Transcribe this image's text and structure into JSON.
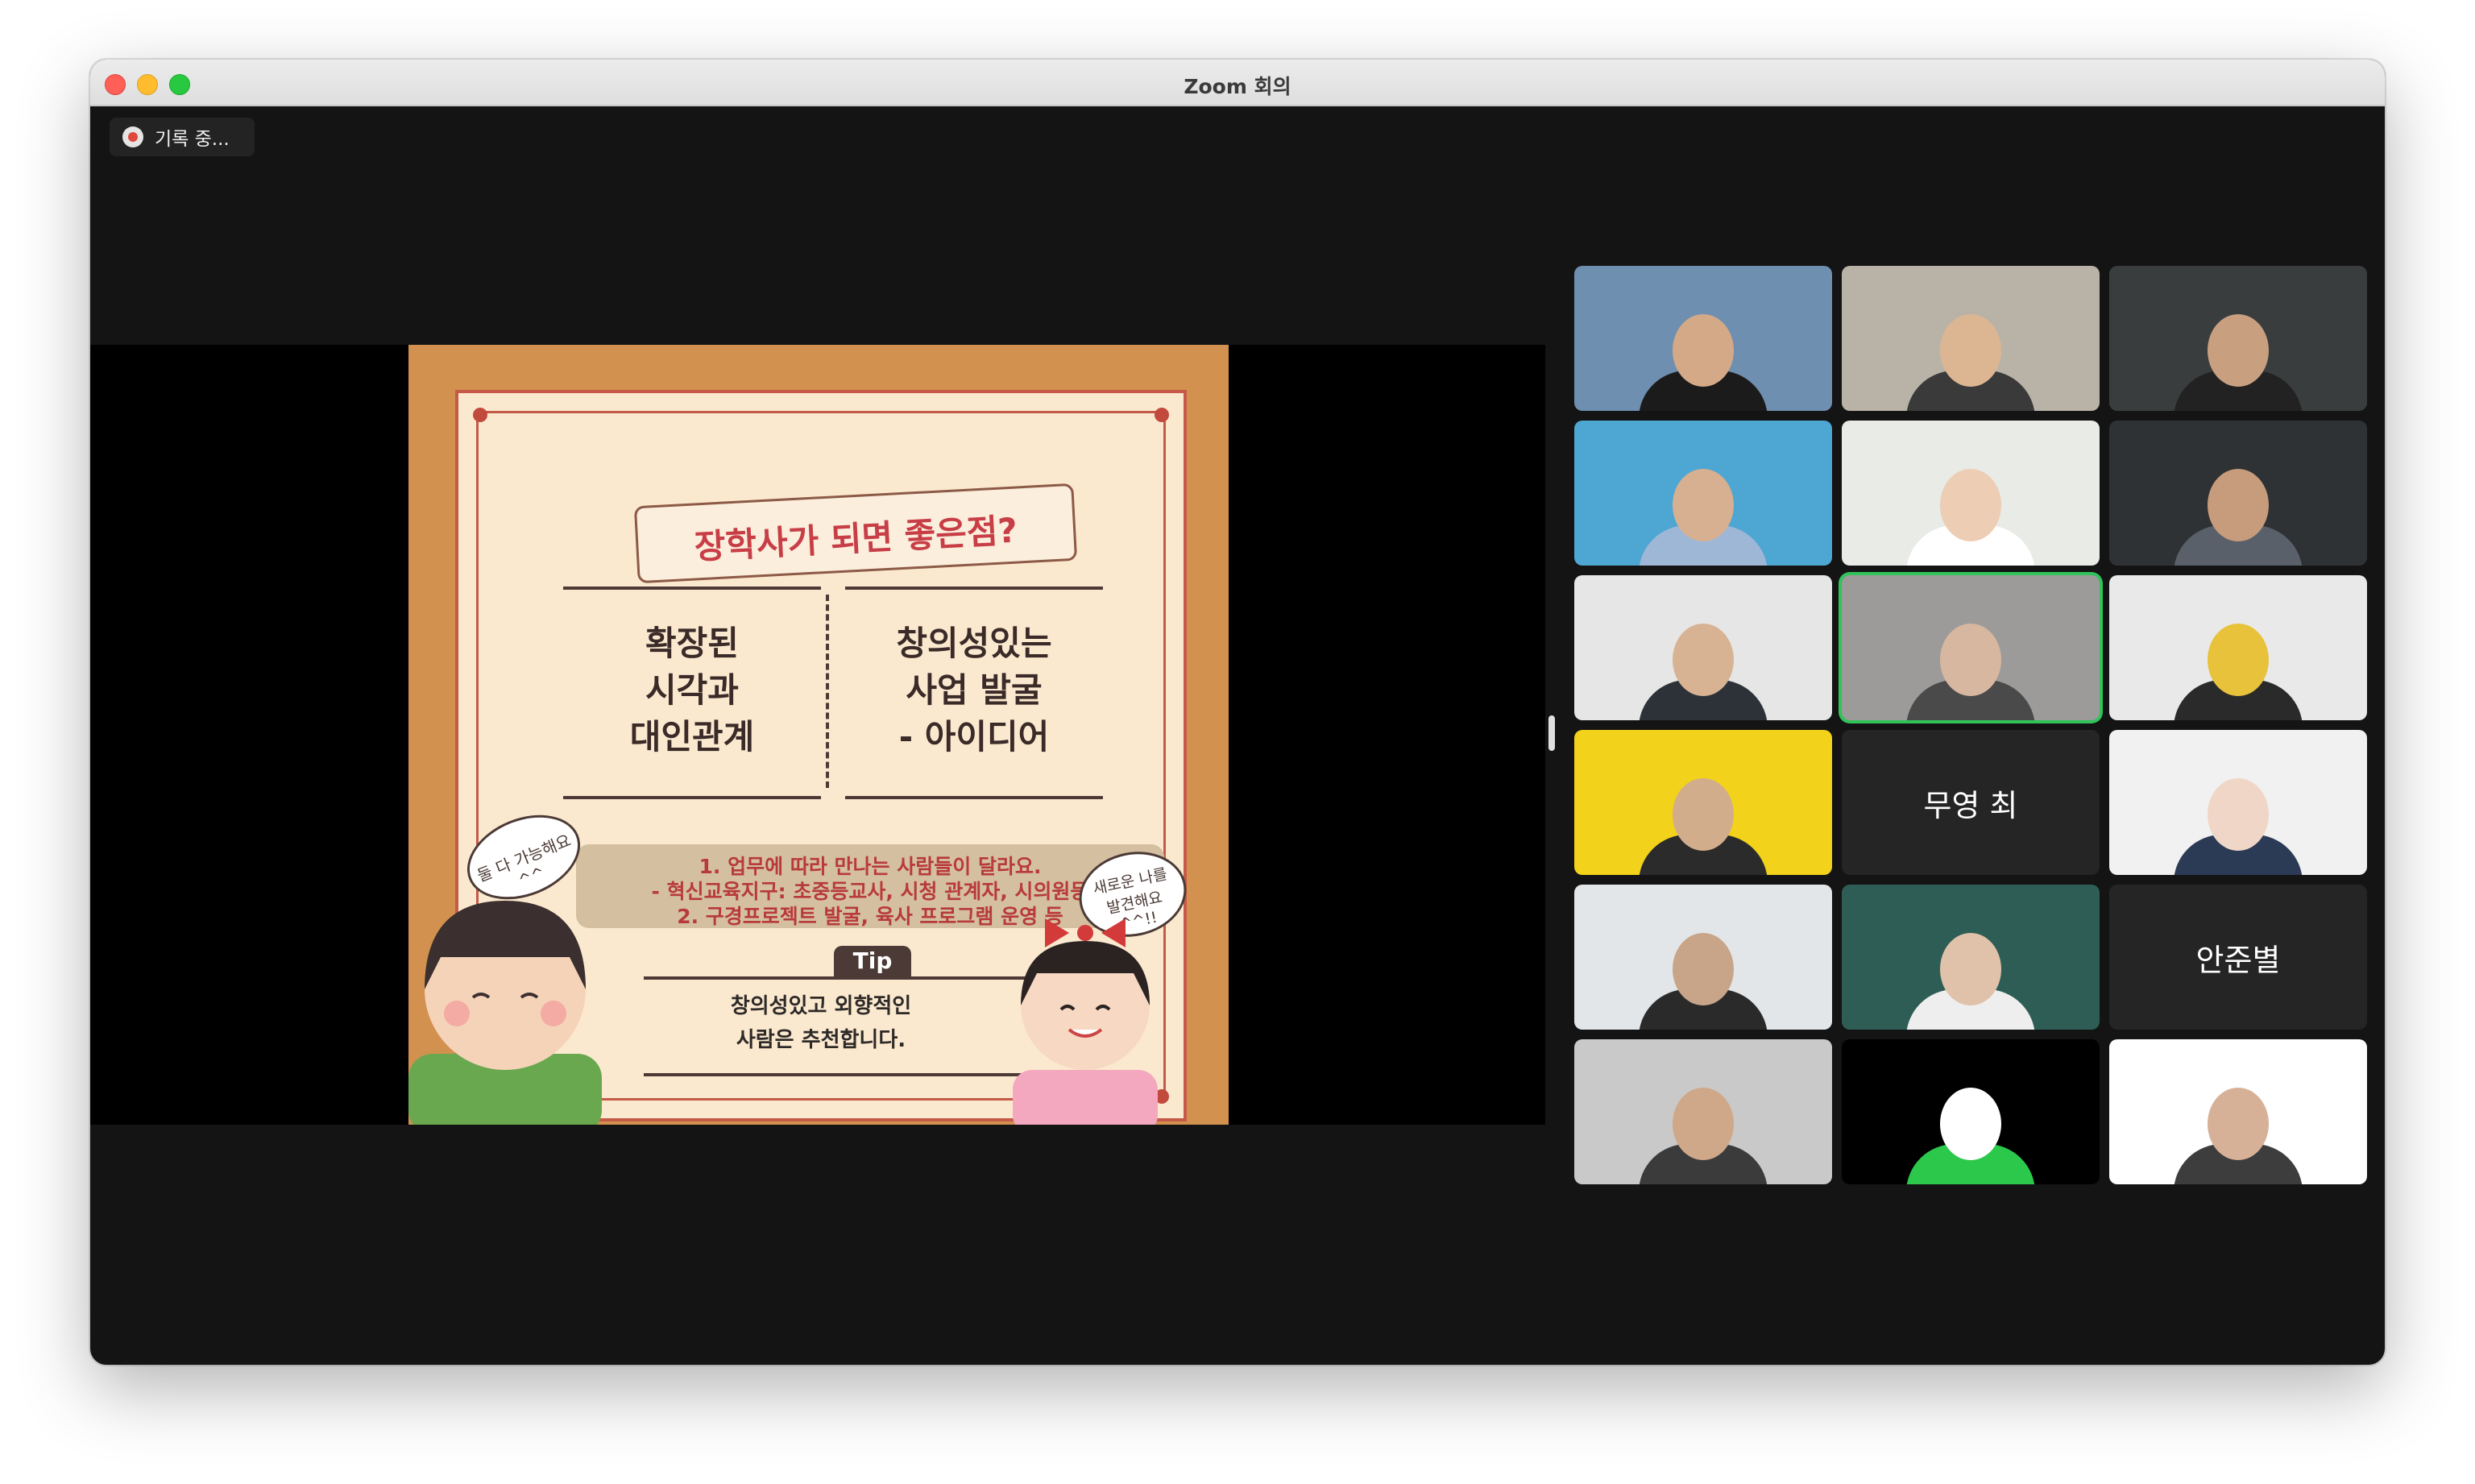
{
  "window": {
    "title": "Zoom 회의"
  },
  "recording": {
    "label": "기록 중..."
  },
  "slide": {
    "title": "장학사가 되면 좋은점?",
    "left_column": "확장된\n시각과\n대인관계",
    "right_column": "창의성있는\n사업 발굴\n- 아이디어",
    "info_line1": "1. 업무에 따라 만나는 사람들이 달라요.",
    "info_line2": "- 혁신교육지구: 초중등교사, 시청 관계자, 시의원등",
    "info_line3": "2. 구경프로젝트 발굴, 육사 프로그램 운영 등",
    "bubble_left": "둘 다 가능해요^^",
    "bubble_right": "새로운 나를 발견해요^^!!",
    "tip_label": "Tip",
    "tip_text": "창의성있고 외향적인\n사람은 추천합니다."
  },
  "participants": [
    {
      "name": "",
      "video": true,
      "bg": "#6f8fb0",
      "skin": "#d4a987",
      "shirt": "#1b1b1b",
      "active": false
    },
    {
      "name": "",
      "video": true,
      "bg": "#b9b3a7",
      "skin": "#dcb693",
      "shirt": "#3a3a3a",
      "active": false
    },
    {
      "name": "",
      "video": true,
      "bg": "#3a3d3e",
      "skin": "#c9a07f",
      "shirt": "#222222",
      "active": false
    },
    {
      "name": "",
      "video": true,
      "bg": "#4ea6d2",
      "skin": "#d6b090",
      "shirt": "#9fb7d6",
      "active": false
    },
    {
      "name": "",
      "video": true,
      "bg": "#e8ebe6",
      "skin": "#edcdb4",
      "shirt": "#ffffff",
      "active": false
    },
    {
      "name": "",
      "video": true,
      "bg": "#2f3235",
      "skin": "#c79c7c",
      "shirt": "#59606a",
      "active": false
    },
    {
      "name": "",
      "video": true,
      "bg": "#e6e6e6",
      "skin": "#d7b394",
      "shirt": "#2d3238",
      "active": false
    },
    {
      "name": "",
      "video": true,
      "bg": "#9c9b99",
      "skin": "#d8b7a0",
      "shirt": "#4a4a4a",
      "active": true
    },
    {
      "name": "",
      "video": true,
      "bg": "#e9e9e9",
      "skin": "#e8c23a",
      "shirt": "#2a2a2a",
      "active": false
    },
    {
      "name": "",
      "video": true,
      "bg": "#f2d21b",
      "skin": "#d2ad8b",
      "shirt": "#2b2b2b",
      "active": false
    },
    {
      "name": "무영 최",
      "video": false,
      "bg": "#252525",
      "skin": "",
      "shirt": "",
      "active": false
    },
    {
      "name": "",
      "video": true,
      "bg": "#f1f1f1",
      "skin": "#f0d6c6",
      "shirt": "#2b3a55",
      "active": false
    },
    {
      "name": "",
      "video": true,
      "bg": "#e3e6e8",
      "skin": "#c8a589",
      "shirt": "#2a2a2a",
      "active": false
    },
    {
      "name": "",
      "video": true,
      "bg": "#2e5d55",
      "skin": "#e0c2aa",
      "shirt": "#eeeeee",
      "active": false
    },
    {
      "name": "안준별",
      "video": false,
      "bg": "#252525",
      "skin": "",
      "shirt": "",
      "active": false
    },
    {
      "name": "",
      "video": true,
      "bg": "#c9c9c9",
      "skin": "#cfa88a",
      "shirt": "#3b3b3b",
      "active": false
    },
    {
      "name": "",
      "video": true,
      "bg": "#000000",
      "skin": "#ffffff",
      "shirt": "#2cc84b",
      "active": false
    },
    {
      "name": "",
      "video": true,
      "bg": "#ffffff",
      "skin": "#d6b197",
      "shirt": "#3d3d3d",
      "active": false
    }
  ]
}
